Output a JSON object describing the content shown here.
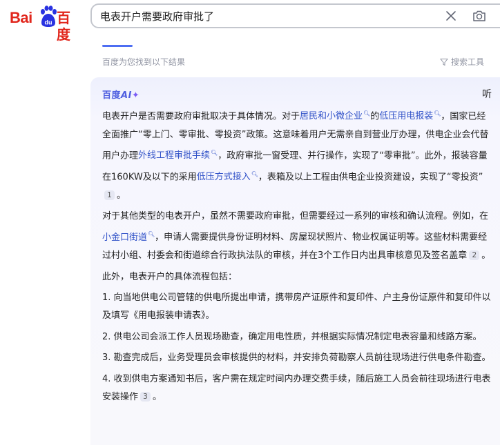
{
  "header": {
    "logo_text_left": "Bai",
    "logo_text_paw": "du",
    "logo_text_right": "百度",
    "search_value": "电表开户需要政府审批了"
  },
  "results": {
    "count_text": "百度为您找到以下结果",
    "tools_label": "搜索工具"
  },
  "ai": {
    "logo_text": "百度",
    "logo_ai": "AI",
    "logo_spark": "✦",
    "listen_label": "听",
    "p1": {
      "t1": "电表开户是否需要政府审批取决于具体情况。对于",
      "l1": "居民和小微企业",
      "t2": "的",
      "l2": "低压用电报装",
      "t3": "，国家已经全面推广“零上门、零审批、零投资”政策。这意味着用户无需亲自到营业厅办理，供电企业会代替用户办理",
      "l3": "外线工程审批手续",
      "t4": "，政府审批一窗受理、并行操作，实现了“零审批”。此外，报装容量在160KW及以下的采用",
      "l4": "低压方式接入",
      "t5": "，表箱及以上工程由供电企业投资建设，实现了“零投资”",
      "ref": "1",
      "t6": "。"
    },
    "p2": {
      "t1": "对于其他类型的电表开户，虽然不需要政府审批，但需要经过一系列的审核和确认流程。例如，在",
      "l1": "小金口街道",
      "t2": "，申请人需要提供身份证明材料、房屋现状照片、物业权属证明等。这些材料需要经过村小组、村委会和街道综合行政执法队的审核，并在3个工作日内出具审核意见及签名盖章",
      "ref": "2",
      "t3": "。"
    },
    "p3": "此外，电表开户的具体流程包括：",
    "steps": [
      "1. 向当地供电公司管辖的供电所提出申请，携带房产证原件和复印件、户主身份证原件和复印件以及填写《用电报装申请表》。",
      "2. 供电公司会派工作人员现场勘查，确定用电性质，并根据实际情况制定电表容量和线路方案。",
      "3. 勘查完成后，业务受理员会审核提供的材料，并安排负荷勘察人员前往现场进行供电条件勘查。"
    ],
    "step4": {
      "t1": "4. 收到供电方案通知书后，客户需在规定时间内办理交费手续，随后施工人员会前往现场进行电表安装操作",
      "ref": "3",
      "t2": "。"
    }
  },
  "colors": {
    "brand_red": "#e1261c",
    "brand_blue": "#2932e1",
    "link": "#3152c8",
    "accent": "#4e6ef2"
  },
  "icons": {
    "clear": "close-icon",
    "camera": "camera-icon",
    "filter": "filter-icon",
    "magnifier": "magnifier-icon"
  }
}
